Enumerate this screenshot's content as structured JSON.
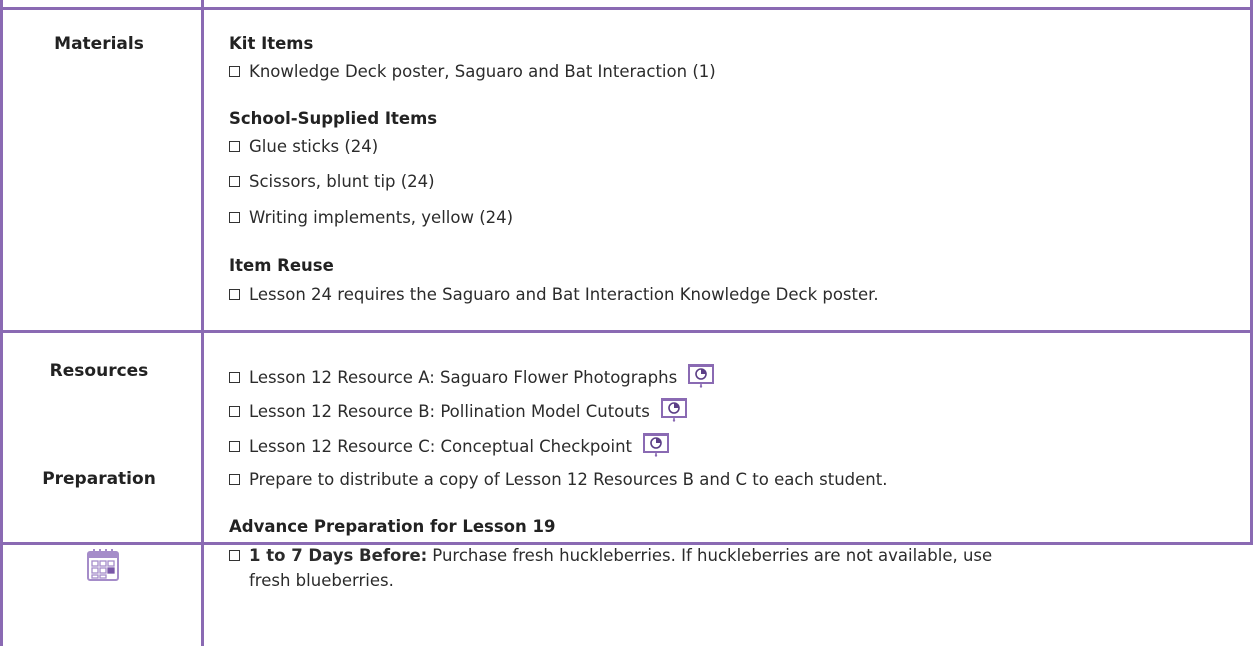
{
  "colors": {
    "border": "#8a6ab3",
    "text": "#2b2b2b",
    "icon": "#8a6ab3"
  },
  "rows": {
    "materials": {
      "label": "Materials",
      "kit": {
        "title": "Kit Items",
        "items": [
          "Knowledge Deck poster, Saguaro and Bat Interaction (1)"
        ]
      },
      "school": {
        "title": "School-Supplied Items",
        "items": [
          "Glue sticks (24)",
          "Scissors, blunt tip (24)",
          "Writing implements, yellow (24)"
        ]
      },
      "reuse": {
        "title": "Item Reuse",
        "items": [
          "Lesson 24 requires the Saguaro and Bat Interaction Knowledge Deck poster."
        ]
      }
    },
    "resources": {
      "label": "Resources",
      "items": [
        {
          "text": "Lesson 12 Resource A: Saguaro Flower Photographs",
          "icon": "projector-slide-icon"
        },
        {
          "text": "Lesson 12 Resource B: Pollination Model Cutouts",
          "icon": "projector-slide-icon"
        },
        {
          "text": "Lesson 12 Resource C: Conceptual Checkpoint",
          "icon": "projector-slide-icon"
        }
      ]
    },
    "preparation": {
      "label": "Preparation",
      "icon": "calendar-icon",
      "items": [
        "Prepare to distribute a copy of Lesson 12 Resources B and C to each student."
      ],
      "advance": {
        "title": "Advance Preparation for Lesson 19",
        "lead": "1 to 7 Days Before:",
        "text_line1": "Purchase fresh huckleberries. If huckleberries are not available, use",
        "text_line2": "fresh blueberries."
      }
    }
  }
}
